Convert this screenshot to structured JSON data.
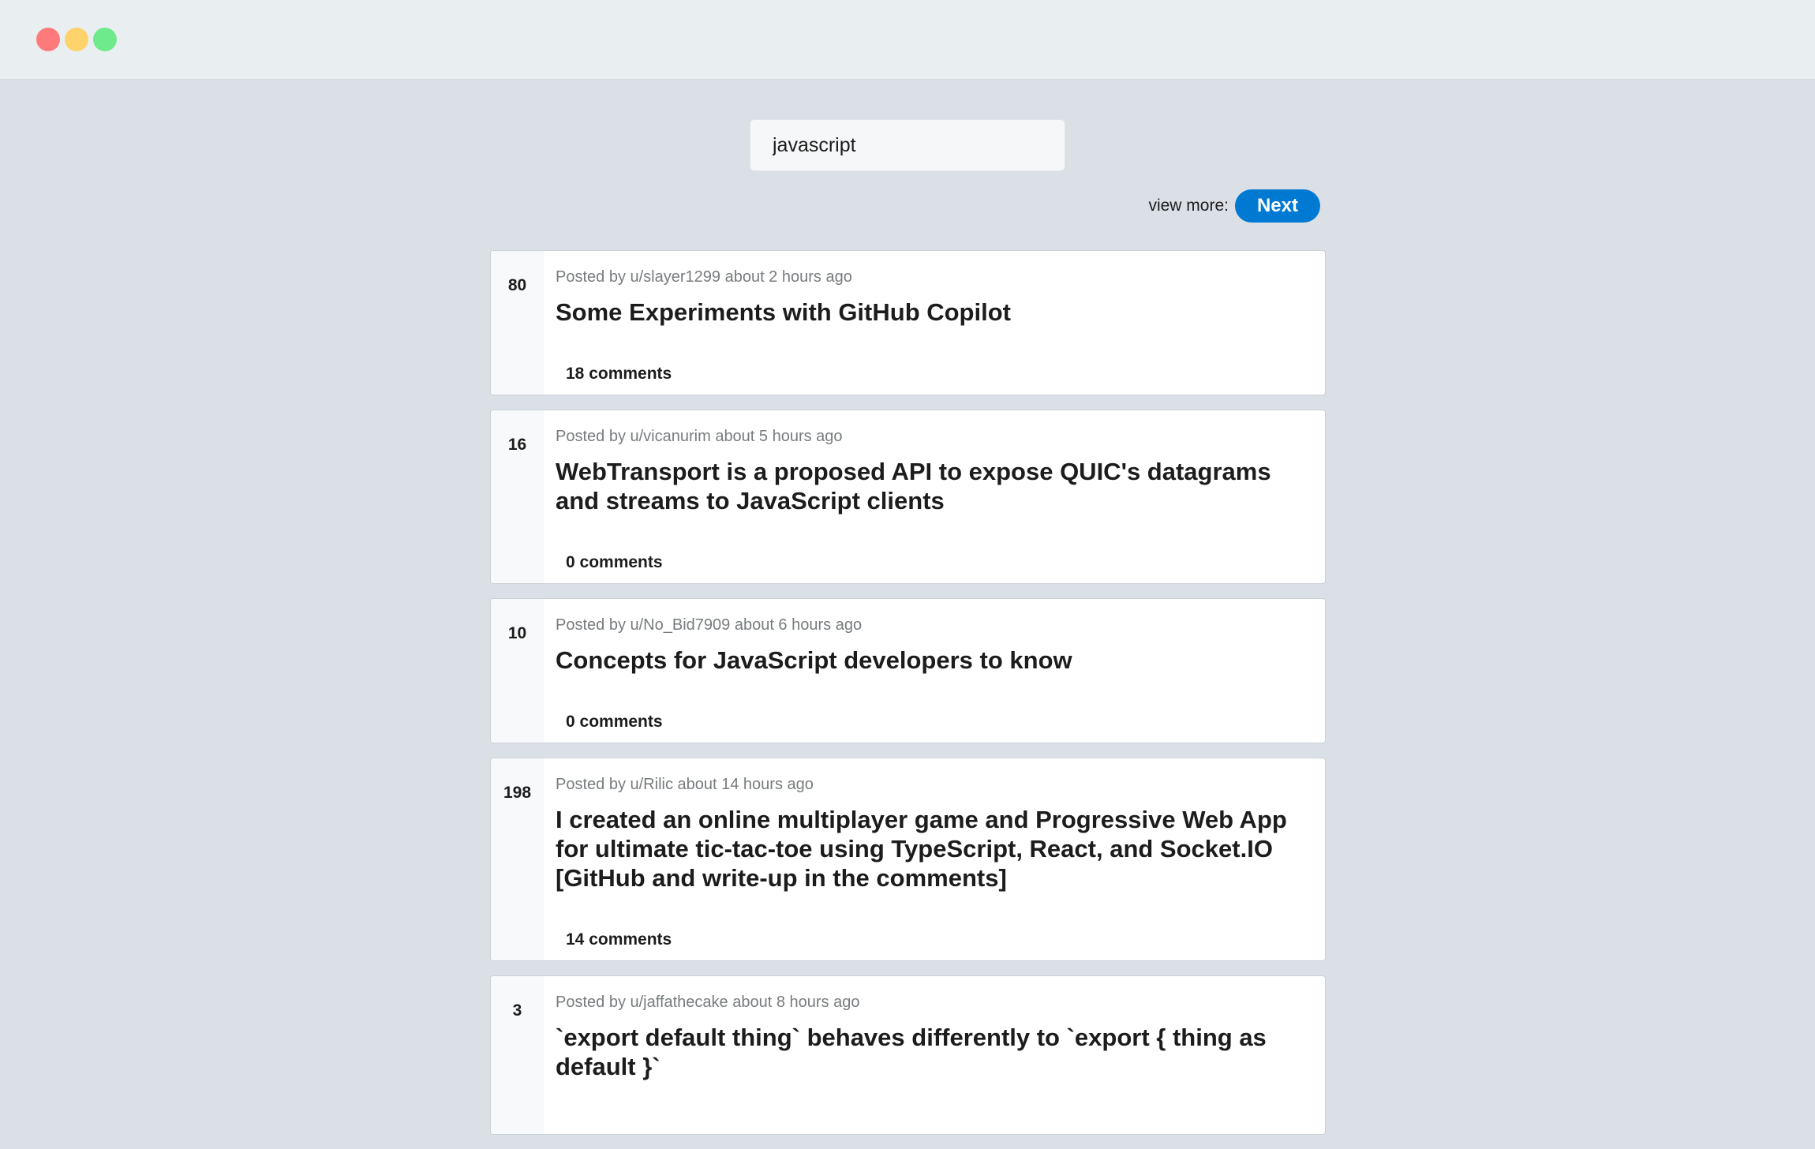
{
  "search": {
    "value": "javascript"
  },
  "pagination": {
    "view_more_label": "view more:",
    "next_label": "Next"
  },
  "posts": [
    {
      "score": "80",
      "meta": "Posted by u/slayer1299 about 2 hours ago",
      "title": "Some Experiments with GitHub Copilot",
      "comments": "18 comments"
    },
    {
      "score": "16",
      "meta": "Posted by u/vicanurim about 5 hours ago",
      "title": "WebTransport is a proposed API to expose QUIC's datagrams and streams to JavaScript clients",
      "comments": "0 comments"
    },
    {
      "score": "10",
      "meta": "Posted by u/No_Bid7909 about 6 hours ago",
      "title": "Concepts for JavaScript developers to know",
      "comments": "0 comments"
    },
    {
      "score": "198",
      "meta": "Posted by u/Rilic about 14 hours ago",
      "title": "I created an online multiplayer game and Progressive Web App for ultimate tic-tac-toe using TypeScript, React, and Socket.IO [GitHub and write-up in the comments]",
      "comments": "14 comments"
    },
    {
      "score": "3",
      "meta": "Posted by u/jaffathecake about 8 hours ago",
      "title": "`export default thing` behaves differently to `export { thing as default }`",
      "comments": ""
    }
  ]
}
